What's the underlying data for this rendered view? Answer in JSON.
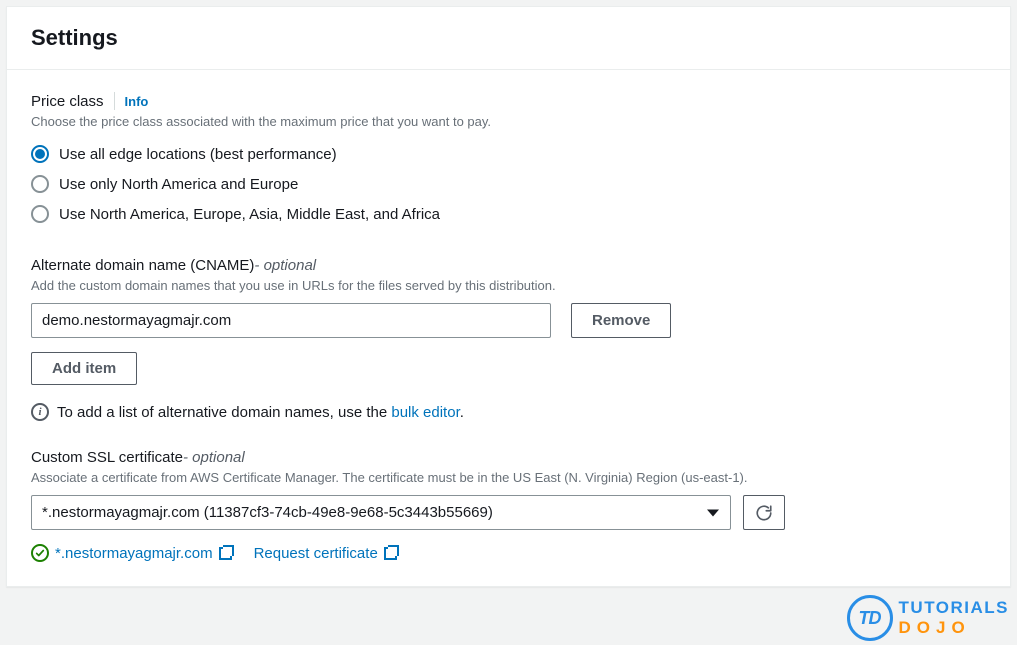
{
  "header": {
    "title": "Settings"
  },
  "price_class": {
    "title": "Price class",
    "info_label": "Info",
    "description": "Choose the price class associated with the maximum price that you want to pay.",
    "options": [
      {
        "label": "Use all edge locations (best performance)",
        "selected": true
      },
      {
        "label": "Use only North America and Europe",
        "selected": false
      },
      {
        "label": "Use North America, Europe, Asia, Middle East, and Africa",
        "selected": false
      }
    ]
  },
  "cname": {
    "title": "Alternate domain name (CNAME)",
    "optional": " - optional",
    "description": "Add the custom domain names that you use in URLs for the files served by this distribution.",
    "value": "demo.nestormayagmajr.com",
    "remove_label": "Remove",
    "add_label": "Add item",
    "hint_prefix": "To add a list of alternative domain names, use the ",
    "hint_link": "bulk editor",
    "hint_suffix": "."
  },
  "ssl": {
    "title": "Custom SSL certificate",
    "optional": " - optional",
    "description": "Associate a certificate from AWS Certificate Manager. The certificate must be in the US East (N. Virginia) Region (us-east-1).",
    "selected": "*.nestormayagmajr.com (11387cf3-74cb-49e8-9e68-5c3443b55669)",
    "validated_domain": "*.nestormayagmajr.com",
    "request_label": "Request certificate"
  },
  "watermark": {
    "brand_top": "TUTORIALS",
    "brand_bottom": "DOJO",
    "logo": "TD"
  }
}
